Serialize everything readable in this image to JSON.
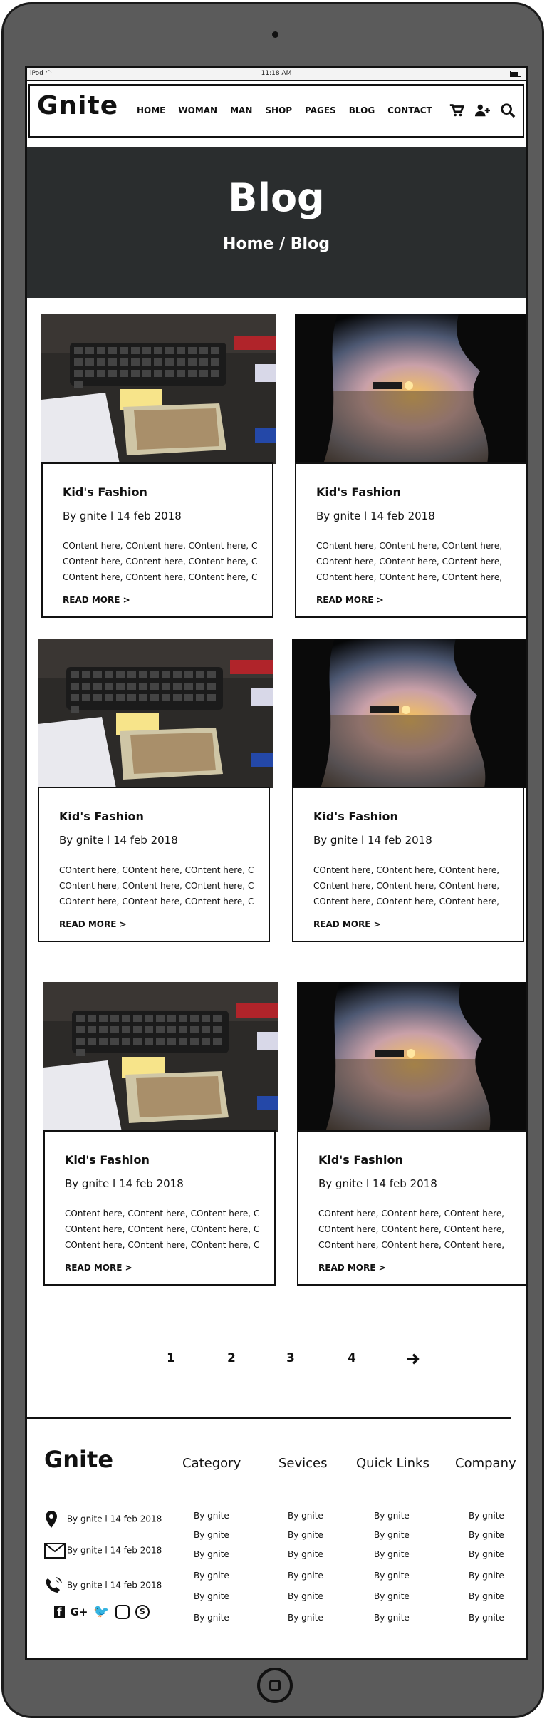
{
  "device": {
    "carrier": "iPod",
    "time": "11:18 AM"
  },
  "navbar": {
    "logo": "Gnite",
    "menu": [
      "HOME",
      "WOMAN",
      "MAN",
      "SHOP",
      "PAGES",
      "BLOG",
      "CONTACT"
    ],
    "icons": [
      "cart-icon",
      "add-user-icon",
      "search-icon"
    ]
  },
  "hero": {
    "title": "Blog",
    "breadcrumb": "Home / Blog"
  },
  "posts": [
    {
      "title": "Kid's Fashion",
      "meta": "By gnite l 14 feb 2018",
      "lines": [
        "COntent here, COntent here, COntent here, C",
        "COntent here, COntent here, COntent here, C",
        "COntent here, COntent here, COntent here, C"
      ],
      "read_more": "READ MORE >",
      "image": "desk-money"
    },
    {
      "title": "Kid's Fashion",
      "meta": "By gnite l 14 feb 2018",
      "lines": [
        "COntent here, COntent here, COntent here,",
        "COntent here, COntent here, COntent here,",
        "COntent here, COntent here, COntent here,"
      ],
      "read_more": "READ MORE >",
      "image": "sunset-lake"
    },
    {
      "title": "Kid's Fashion",
      "meta": "By gnite l 14 feb 2018",
      "lines": [
        "COntent here, COntent here, COntent here, C",
        "COntent here, COntent here, COntent here, C",
        "COntent here, COntent here, COntent here, C"
      ],
      "read_more": "READ MORE >",
      "image": "desk-money"
    },
    {
      "title": "Kid's Fashion",
      "meta": "By gnite l 14 feb 2018",
      "lines": [
        "COntent here, COntent here, COntent here,",
        "COntent here, COntent here, COntent here,",
        "COntent here, COntent here, COntent here,"
      ],
      "read_more": "READ MORE >",
      "image": "sunset-lake"
    },
    {
      "title": "Kid's Fashion",
      "meta": "By gnite l 14 feb 2018",
      "lines": [
        "COntent here, COntent here, COntent here, C",
        "COntent here, COntent here, COntent here, C",
        "COntent here, COntent here, COntent here, C"
      ],
      "read_more": "READ MORE >",
      "image": "desk-money"
    },
    {
      "title": "Kid's Fashion",
      "meta": "By gnite l 14 feb 2018",
      "lines": [
        "COntent here, COntent here, COntent here,",
        "COntent here, COntent here, COntent here,",
        "COntent here, COntent here, COntent here,"
      ],
      "read_more": "READ MORE >",
      "image": "sunset-lake"
    }
  ],
  "pagination": {
    "pages": [
      "1",
      "2",
      "3",
      "4"
    ],
    "next": "arrow-right-icon"
  },
  "footer": {
    "logo": "Gnite",
    "headings": [
      "Category",
      "Sevices",
      "Quick Links",
      "Company"
    ],
    "contacts": [
      {
        "icon": "location-pin-icon",
        "text": "By gnite l 14 feb 2018"
      },
      {
        "icon": "envelope-icon",
        "text": "By gnite l 14 feb 2018"
      },
      {
        "icon": "phone-icon",
        "text": "By gnite l 14 feb 2018"
      }
    ],
    "column_item": "By gnite",
    "social": [
      "facebook-icon",
      "google-plus-icon",
      "twitter-icon",
      "instagram-icon",
      "skype-icon"
    ]
  }
}
